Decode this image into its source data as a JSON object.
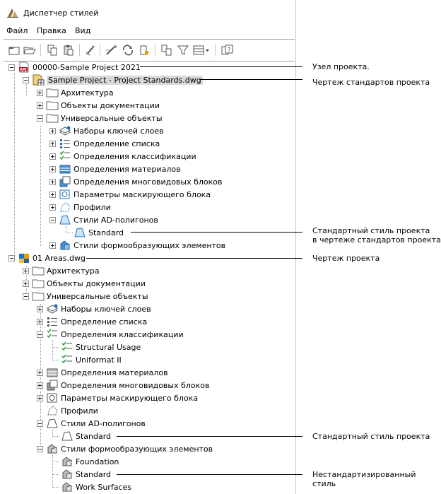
{
  "window": {
    "title": "Диспетчер стилей"
  },
  "menu": {
    "file": "Файл",
    "edit": "Правка",
    "view": "Вид"
  },
  "toolbar": {
    "icons": [
      "new-icon",
      "open-icon",
      "copy-icon",
      "paste-icon",
      "purge-icon",
      "edit-style-icon",
      "sync-icon",
      "lock-icon",
      "toggle-view-icon",
      "filter-icon",
      "view-options-icon",
      "help-icon"
    ]
  },
  "tree": {
    "project": "00000-Sample Project 2021",
    "standards_drawing": "Sample Project - Project Standards.dwg",
    "s_arch": "Архитектура",
    "s_doc": "Объекты документации",
    "s_multi": "Универсальные объекты",
    "s_layer_keys": "Наборы ключей слоев",
    "s_list": "Определение списка",
    "s_class": "Определения классификации",
    "s_mat": "Определения материалов",
    "s_mvb": "Определения многовидовых блоков",
    "s_mask": "Параметры маскирующего блока",
    "s_profiles": "Профили",
    "s_aec_polygon": "Стили AD-полигонов",
    "s_aec_standard": "Standard",
    "s_mass": "Стили формообразующих элементов",
    "areas_drawing": "01 Areas.dwg",
    "a_arch": "Архитектура",
    "a_doc": "Объекты документации",
    "a_multi": "Универсальные объекты",
    "a_layer_keys": "Наборы ключей слоев",
    "a_list": "Определение списка",
    "a_class": "Определения классификации",
    "a_structural": "Structural Usage",
    "a_uniformat": "Uniformat II",
    "a_mat": "Определения материалов",
    "a_mvb": "Определения многовидовых блоков",
    "a_mask": "Параметры маскирующего блока",
    "a_profiles": "Профили",
    "a_aec_polygon": "Стили AD-полигонов",
    "a_aec_standard": "Standard",
    "a_mass": "Стили формообразующих элементов",
    "a_foundation": "Foundation",
    "a_mass_standard": "Standard",
    "a_work": "Work Surfaces"
  },
  "callouts": {
    "project_node": "Узел проекта.",
    "standards_drawing": "Чертеж стандартов проекта",
    "standard_style_line1": "Стандартный стиль проекта",
    "standard_style_line2": "в чертеже стандартов проекта",
    "project_drawing": "Чертеж проекта",
    "project_standard_style": "Стандартный стиль проекта",
    "nonstandard_style": "Нестандартизированный стиль"
  }
}
